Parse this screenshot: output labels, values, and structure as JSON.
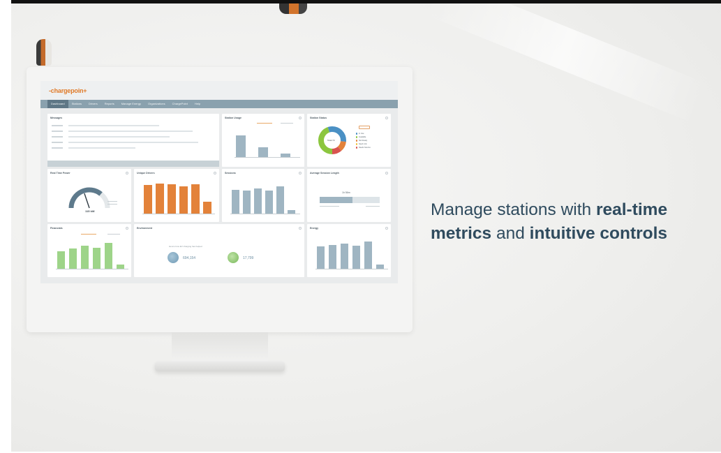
{
  "headline": {
    "line1_plain": "Manage stations with ",
    "line1_bold": "real-time",
    "line2_bold_a": "metrics",
    "line2_plain": " and ",
    "line2_bold_b": "intuitive controls"
  },
  "colors": {
    "accent": "#e07a28",
    "nav": "#8aa1ae",
    "headline": "#2f4b5e",
    "bar_blue": "#9fb5c2",
    "bar_orange": "#e3823a",
    "bar_green": "#9ed489"
  },
  "app": {
    "logo": "-chargepoin+",
    "nav": [
      "Dashboard",
      "Stations",
      "Drivers",
      "Reports",
      "Manage Energy",
      "Organizations",
      "ChargePoint",
      "Help"
    ]
  },
  "cards": {
    "messages": {
      "title": "Messages"
    },
    "station_usage": {
      "title": "Station Usage",
      "values": [
        0.78,
        0.34,
        0.12
      ]
    },
    "station_status": {
      "title": "Station Status",
      "center_label": "Total 72",
      "legend": [
        "In Use",
        "Available",
        "Not Ready",
        "Need Link",
        "Needs Service"
      ]
    },
    "real_time_power": {
      "title": "Real Time Power",
      "value": "115 kW",
      "gauge_level": 0.72
    },
    "unique_drivers": {
      "title": "Unique Drivers",
      "values": [
        0.85,
        0.9,
        0.88,
        0.82,
        0.88,
        0.35
      ]
    },
    "sessions": {
      "title": "Sessions",
      "values": [
        0.78,
        0.75,
        0.82,
        0.75,
        0.88,
        0.12
      ]
    },
    "average_session_length": {
      "title": "Average Session Length",
      "value": "1h 56m",
      "fill": 0.55
    },
    "financials": {
      "title": "Financials",
      "values": [
        0.62,
        0.72,
        0.82,
        0.74,
        0.92,
        0.16
      ]
    },
    "environment": {
      "title": "Environment",
      "caption": "Here's how EV charging has helped",
      "value_a": "694,154",
      "value_b": "17,799"
    },
    "energy": {
      "title": "Energy",
      "values": [
        0.72,
        0.78,
        0.82,
        0.75,
        0.88,
        0.14
      ]
    }
  }
}
